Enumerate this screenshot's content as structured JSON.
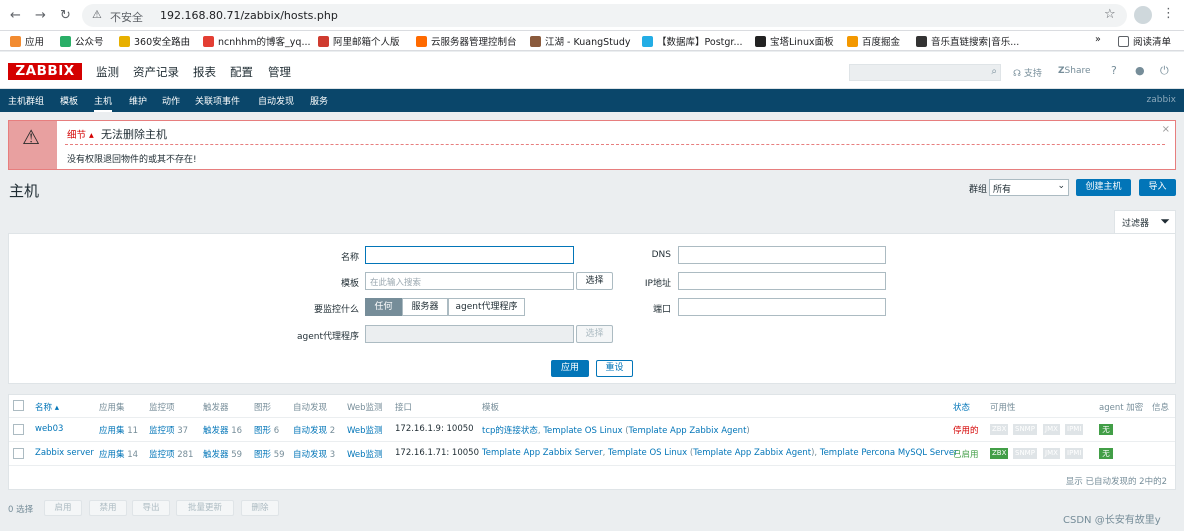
{
  "browser": {
    "insecure_label": "不安全",
    "url": "192.168.80.71/zabbix/hosts.php",
    "bookmarks": [
      "应用",
      "公众号",
      "360安全路由",
      "ncnhhm的博客_yq...",
      "阿里邮箱个人版",
      "云服务器管理控制台",
      "江湖 - KuangStudy",
      "【数据库】Postgr...",
      "宝塔Linux面板",
      "百度掘金",
      "音乐直链搜索|音乐...",
      "阅读清单"
    ],
    "more": "»"
  },
  "header": {
    "logo": "ZABBIX",
    "menu": [
      "监测",
      "资产记录",
      "报表",
      "配置",
      "管理"
    ],
    "support": "支持",
    "share": "Share",
    "help": "?",
    "user_icon": "user-icon",
    "logout_icon": "power-icon"
  },
  "subnav": {
    "items": [
      "主机群组",
      "模板",
      "主机",
      "维护",
      "动作",
      "关联项事件",
      "自动发现",
      "服务"
    ],
    "active": "主机",
    "right": "zabbix"
  },
  "alert": {
    "details": "细节 ▴",
    "title": "无法删除主机",
    "message": "没有权限退回物件的或其不存在!",
    "close": "×"
  },
  "page": {
    "title": "主机",
    "group_label": "群组",
    "group_value": "所有",
    "create_button": "创建主机",
    "import_button": "导入",
    "filter_tab": "过滤器"
  },
  "filter": {
    "name_label": "名称",
    "name_value": "",
    "template_label": "模板",
    "template_placeholder": "在此输入搜索",
    "select_button": "选择",
    "monitored_label": "要监控什么",
    "monitored_options": [
      "任何",
      "服务器",
      "agent代理程序"
    ],
    "monitored_selected": "任何",
    "proxy_label": "agent代理程序",
    "proxy_select": "选择",
    "dns_label": "DNS",
    "ip_label": "IP地址",
    "port_label": "端口",
    "apply": "应用",
    "reset": "重设"
  },
  "table": {
    "headers": [
      "名称 ▴",
      "应用集",
      "监控项",
      "触发器",
      "图形",
      "自动发现",
      "Web监测",
      "接口",
      "模板",
      "状态",
      "可用性",
      "agent 加密",
      "信息"
    ],
    "rows": [
      {
        "name": "web03",
        "apps": "应用集",
        "apps_n": "11",
        "items": "监控项",
        "items_n": "37",
        "triggers": "触发器",
        "triggers_n": "16",
        "graphs": "图形",
        "graphs_n": "6",
        "discovery": "自动发现",
        "discovery_n": "2",
        "web": "Web监测",
        "interface": "172.16.1.9: 10050",
        "tpl1": "tcp的连接状态",
        "sep1": ", ",
        "tpl2": "Template OS Linux",
        "tpl2b": " (",
        "tpl3": "Template App Zabbix Agent",
        "tpl3b": ")",
        "status": "停用的",
        "avail": [
          "ZBX",
          "SNMP",
          "JMX",
          "IPMI"
        ],
        "zbx_ok": false,
        "enc": "无"
      },
      {
        "name": "Zabbix server",
        "apps": "应用集",
        "apps_n": "14",
        "items": "监控项",
        "items_n": "281",
        "triggers": "触发器",
        "triggers_n": "59",
        "graphs": "图形",
        "graphs_n": "59",
        "discovery": "自动发现",
        "discovery_n": "3",
        "web": "Web监测",
        "interface": "172.16.1.71: 10050",
        "tpl1": "Template App Zabbix Server",
        "sep1": ", ",
        "tpl2": "Template OS Linux",
        "tpl2b": " (",
        "tpl3": "Template App Zabbix Agent",
        "tpl3b": "), ",
        "tpl4": "Template Percona MySQL Server",
        "status": "已启用",
        "avail": [
          "ZBX",
          "SNMP",
          "JMX",
          "IPMI"
        ],
        "zbx_ok": true,
        "enc": "无"
      }
    ],
    "footer": "显示 已自动发现的 2中的2"
  },
  "actions": {
    "selected": "0 选择",
    "buttons": [
      "启用",
      "禁用",
      "导出",
      "批量更新",
      "删除"
    ]
  },
  "watermark": "CSDN @长安有故里y"
}
